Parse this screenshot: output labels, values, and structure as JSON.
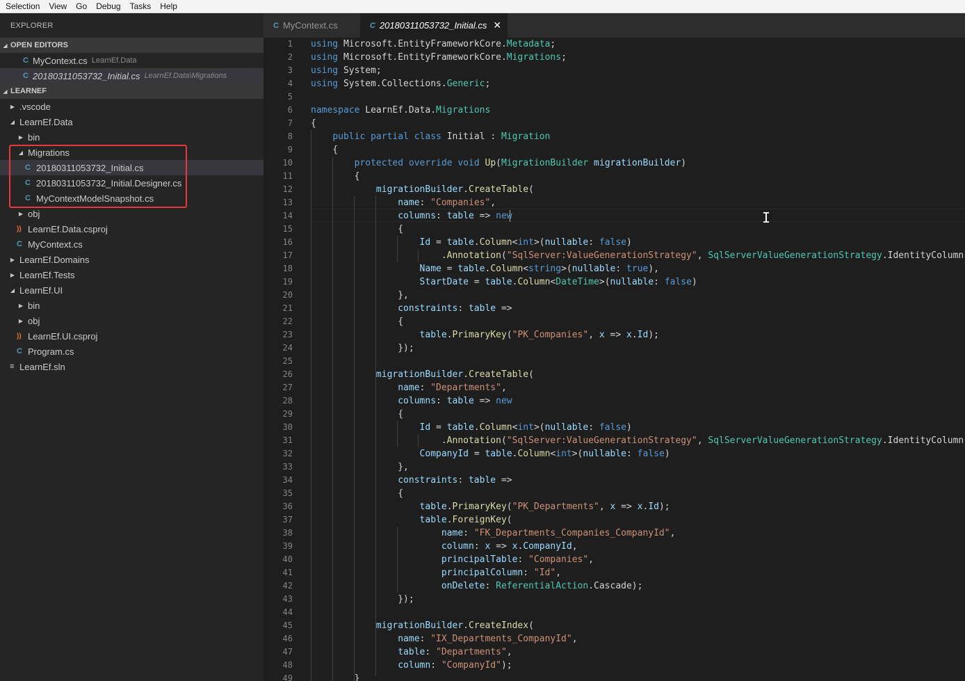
{
  "menu": [
    "Selection",
    "View",
    "Go",
    "Debug",
    "Tasks",
    "Help"
  ],
  "explorer": {
    "title": "EXPLORER",
    "open_editors": {
      "label": "OPEN EDITORS",
      "items": [
        {
          "name": "MyContext.cs",
          "path": "LearnEf.Data"
        },
        {
          "name": "20180311053732_Initial.cs",
          "path": "LearnEf.Data\\Migrations"
        }
      ]
    },
    "workspace": {
      "label": "LEARNEF",
      "items": [
        ".vscode",
        "LearnEf.Data",
        "bin",
        "Migrations",
        "20180311053732_Initial.cs",
        "20180311053732_Initial.Designer.cs",
        "MyContextModelSnapshot.cs",
        "obj",
        "LearnEf.Data.csproj",
        "MyContext.cs",
        "LearnEf.Domains",
        "LearnEf.Tests",
        "LearnEf.UI",
        "bin",
        "obj",
        "LearnEf.UI.csproj",
        "Program.cs",
        "LearnEf.sln"
      ]
    }
  },
  "tabs": [
    {
      "label": "MyContext.cs",
      "active": false
    },
    {
      "label": "20180311053732_Initial.cs",
      "active": true,
      "close": "✕"
    }
  ],
  "editor": {
    "line_numbers": [
      "1",
      "2",
      "3",
      "4",
      "5",
      "6",
      "7",
      "8",
      "9",
      "10",
      "11",
      "12",
      "13",
      "14",
      "15",
      "16",
      "17",
      "18",
      "19",
      "20",
      "21",
      "22",
      "23",
      "24",
      "25",
      "26",
      "27",
      "28",
      "29",
      "30",
      "31",
      "32",
      "33",
      "34",
      "35",
      "36",
      "37",
      "38",
      "39",
      "40",
      "41",
      "42",
      "43",
      "44",
      "45",
      "46",
      "47",
      "48",
      "49"
    ],
    "lines": [
      "using Microsoft.EntityFrameworkCore.Metadata;",
      "using Microsoft.EntityFrameworkCore.Migrations;",
      "using System;",
      "using System.Collections.Generic;",
      "",
      "namespace LearnEf.Data.Migrations",
      "{",
      "    public partial class Initial : Migration",
      "    {",
      "        protected override void Up(MigrationBuilder migrationBuilder)",
      "        {",
      "            migrationBuilder.CreateTable(",
      "                name: \"Companies\",",
      "                columns: table => new",
      "                {",
      "                    Id = table.Column<int>(nullable: false)",
      "                        .Annotation(\"SqlServer:ValueGenerationStrategy\", SqlServerValueGenerationStrategy.IdentityColumn),",
      "                    Name = table.Column<string>(nullable: true),",
      "                    StartDate = table.Column<DateTime>(nullable: false)",
      "                },",
      "                constraints: table =>",
      "                {",
      "                    table.PrimaryKey(\"PK_Companies\", x => x.Id);",
      "                });",
      "",
      "            migrationBuilder.CreateTable(",
      "                name: \"Departments\",",
      "                columns: table => new",
      "                {",
      "                    Id = table.Column<int>(nullable: false)",
      "                        .Annotation(\"SqlServer:ValueGenerationStrategy\", SqlServerValueGenerationStrategy.IdentityColumn),",
      "                    CompanyId = table.Column<int>(nullable: false)",
      "                },",
      "                constraints: table =>",
      "                {",
      "                    table.PrimaryKey(\"PK_Departments\", x => x.Id);",
      "                    table.ForeignKey(",
      "                        name: \"FK_Departments_Companies_CompanyId\",",
      "                        column: x => x.CompanyId,",
      "                        principalTable: \"Companies\",",
      "                        principalColumn: \"Id\",",
      "                        onDelete: ReferentialAction.Cascade);",
      "                });",
      "",
      "            migrationBuilder.CreateIndex(",
      "                name: \"IX_Departments_CompanyId\",",
      "                table: \"Departments\",",
      "                column: \"CompanyId\");",
      "        }"
    ]
  }
}
